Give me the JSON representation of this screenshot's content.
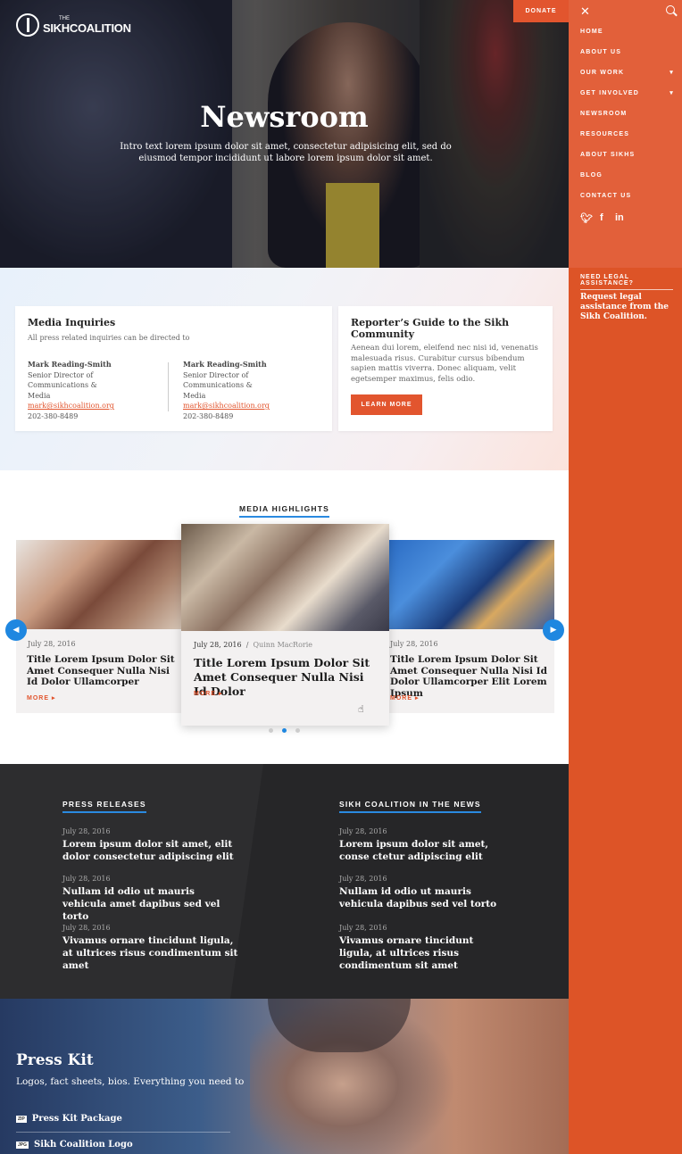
{
  "header": {
    "logo_small": "THE",
    "logo_name": "SIKHCOALITION",
    "donate_label": "DONATE"
  },
  "hero": {
    "title": "Newsroom",
    "intro": "Intro text lorem ipsum dolor sit amet, consectetur adipisicing elit, sed do eiusmod tempor incididunt ut labore lorem ipsum dolor sit amet."
  },
  "sidebar": {
    "nav": [
      {
        "label": "HOME"
      },
      {
        "label": "ABOUT US"
      },
      {
        "label": "OUR WORK",
        "chevron": "chevron-down-icon"
      },
      {
        "label": "GET INVOLVED",
        "chevron": "chevron-down-icon"
      },
      {
        "label": "NEWSROOM"
      },
      {
        "label": "RESOURCES"
      },
      {
        "label": "ABOUT SIKHS"
      },
      {
        "label": "BLOG"
      },
      {
        "label": "CONTACT US"
      }
    ],
    "social": [
      "twitter-icon",
      "facebook-icon",
      "linkedin-icon"
    ],
    "legal_heading": "NEED LEGAL ASSISTANCE?",
    "legal_text": "Request legal assistance from the Sikh Coalition."
  },
  "media_inquiries": {
    "title": "Media Inquiries",
    "subtitle": "All press related inquiries can be directed to",
    "contacts": [
      {
        "name": "Mark Reading-Smith",
        "role": "Senior Director of Communications & Media",
        "email": "mark@sikhcoalition.org",
        "phone": "202-380-8489"
      },
      {
        "name": "Mark Reading-Smith",
        "role": "Senior Director of Communications & Media",
        "email": "mark@sikhcoalition.org",
        "phone": "202-380-8489"
      }
    ]
  },
  "reporters_guide": {
    "title": "Reporter’s Guide to the Sikh Community",
    "text": "Aenean dui lorem, eleifend nec nisi id, venenatis malesuada risus. Curabitur cursus bibendum sapien mattis viverra. Donec aliquam, velit egetsemper maximus, felis odio.",
    "button": "LEARN MORE"
  },
  "highlights": {
    "title": "MEDIA HIGHLIGHTS",
    "cards": [
      {
        "date": "July 28, 2016",
        "author": "",
        "title": "Title Lorem Ipsum Dolor Sit Amet Consequer Nulla Nisi Id Dolor Ullamcorper",
        "more": "MORE ▸"
      },
      {
        "date": "July 28, 2016",
        "author": "Quinn MacRorie",
        "title": "Title Lorem Ipsum Dolor Sit Amet Consequer Nulla Nisi Id Dolor",
        "more": "MORE ▸"
      },
      {
        "date": "July 28, 2016",
        "author": "",
        "title": "Title Lorem Ipsum Dolor Sit Amet Consequer Nulla Nisi Id Dolor Ullamcorper Elit Lorem Ipsum",
        "more": "MORE ▸"
      }
    ],
    "pagination": {
      "pages": 3,
      "active": 2
    }
  },
  "press_releases": {
    "title": "PRESS RELEASES",
    "items": [
      {
        "date": "July 28, 2016",
        "headline": "Lorem ipsum dolor sit amet, elit dolor consectetur adipiscing elit"
      },
      {
        "date": "July 28, 2016",
        "headline": "Nullam id odio ut mauris vehicula amet dapibus sed vel torto"
      },
      {
        "date": "July 28, 2016",
        "headline": "Vivamus ornare tincidunt ligula, at ultrices risus condimentum sit amet"
      }
    ]
  },
  "in_the_news": {
    "title": "SIKH COALITION IN THE NEWS",
    "items": [
      {
        "date": "July 28, 2016",
        "headline": "Lorem ipsum dolor sit amet, conse ctetur adipiscing elit"
      },
      {
        "date": "July 28, 2016",
        "headline": "Nullam id odio ut mauris vehicula dapibus sed vel torto"
      },
      {
        "date": "July 28, 2016",
        "headline": "Vivamus ornare tincidunt ligula, at ultrices risus condimentum sit amet"
      }
    ]
  },
  "press_kit": {
    "title": "Press Kit",
    "subtitle": "Logos, fact sheets, bios. Everything you need to",
    "items": [
      {
        "tag": "ZIP",
        "label": "Press Kit Package"
      },
      {
        "tag": "JPG",
        "label": "Sikh Coalition Logo"
      }
    ]
  },
  "colors": {
    "accent": "#e2552e",
    "sidebar": "#dd5427",
    "link_blue": "#1f87e0",
    "dark": "#2d2d2f"
  }
}
